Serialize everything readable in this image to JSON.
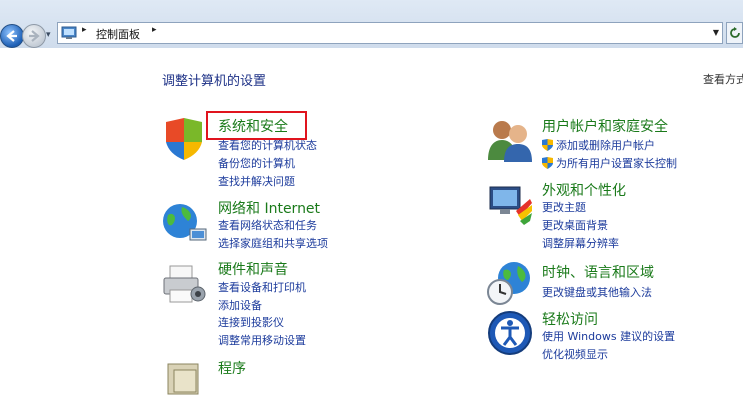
{
  "address_bar": {
    "breadcrumb": "控制面板"
  },
  "page": {
    "title": "调整计算机的设置",
    "view_by": "查看方式"
  },
  "left_column": [
    {
      "title": "系统和安全",
      "icon": "shield-flag-icon",
      "links": [
        "查看您的计算机状态",
        "备份您的计算机",
        "查找并解决问题"
      ]
    },
    {
      "title": "网络和 Internet",
      "icon": "network-globe-icon",
      "links": [
        "查看网络状态和任务",
        "选择家庭组和共享选项"
      ]
    },
    {
      "title": "硬件和声音",
      "icon": "printer-icon",
      "links": [
        "查看设备和打印机",
        "添加设备",
        "连接到投影仪",
        "调整常用移动设置"
      ]
    },
    {
      "title": "程序",
      "icon": "programs-icon",
      "links": []
    }
  ],
  "right_column": [
    {
      "title": "用户帐户和家庭安全",
      "icon": "users-icon",
      "links": [
        "添加或删除用户帐户",
        "为所有用户设置家长控制"
      ]
    },
    {
      "title": "外观和个性化",
      "icon": "monitor-paint-icon",
      "links": [
        "更改主题",
        "更改桌面背景",
        "调整屏幕分辨率"
      ]
    },
    {
      "title": "时钟、语言和区域",
      "icon": "clock-globe-icon",
      "links": [
        "更改键盘或其他输入法"
      ]
    },
    {
      "title": "轻松访问",
      "icon": "ease-of-access-icon",
      "links": [
        "使用 Windows 建议的设置",
        "优化视频显示"
      ]
    }
  ],
  "colors": {
    "category_title": "#1a7a1a",
    "link": "#1c3b9c",
    "highlight_box": "#e0141e"
  }
}
